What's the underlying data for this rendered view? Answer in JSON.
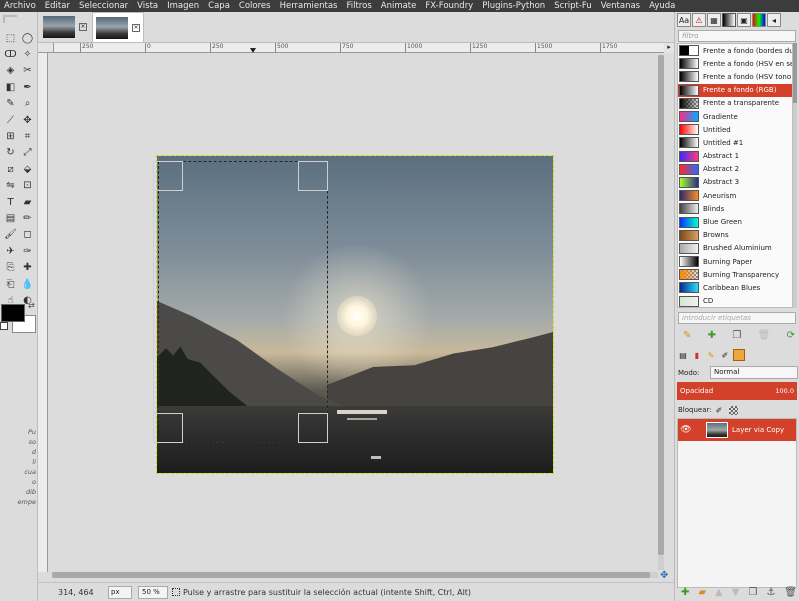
{
  "menu": [
    "Archivo",
    "Editar",
    "Seleccionar",
    "Vista",
    "Imagen",
    "Capa",
    "Colores",
    "Herramientas",
    "Filtros",
    "Animate",
    "FX-Foundry",
    "Plugins-Python",
    "Script-Fu",
    "Ventanas",
    "Ayuda"
  ],
  "toolbox": {
    "tools": [
      "rect-select",
      "ellipse-select",
      "free-select",
      "fuzzy-select",
      "select-by-color",
      "scissors-select",
      "foreground-select",
      "paths",
      "color-picker",
      "zoom",
      "measure",
      "move",
      "align",
      "crop",
      "rotate",
      "scale",
      "shear",
      "perspective",
      "flip",
      "cage-transform",
      "text",
      "bucket-fill",
      "blend",
      "pencil",
      "paintbrush",
      "eraser",
      "airbrush",
      "ink",
      "clone",
      "heal",
      "perspective-clone",
      "blur",
      "smudge",
      "dodge-burn"
    ],
    "options_text": [
      "Pu",
      "so",
      "d",
      "li",
      "cua",
      "o",
      "dib",
      "empe"
    ],
    "fg_color": "#000000",
    "bg_color": "#ffffff"
  },
  "ruler": {
    "labels": [
      "250",
      "0",
      "250",
      "500",
      "750",
      "1000",
      "1250",
      "1500",
      "1750"
    ]
  },
  "statusbar": {
    "coords": "314, 464",
    "unit": "px",
    "zoom": "50 %",
    "message": "Pulse y arrastre para sustituir la selección actual (intente Shift, Ctrl, Alt)"
  },
  "gradients": {
    "filter_placeholder": "filtro",
    "tags_placeholder": "introducir etiquetas",
    "items": [
      {
        "name": "Frente a fondo (bordes duro",
        "colors": [
          "#000000",
          "#ffffff"
        ],
        "hard": true
      },
      {
        "name": "Frente a fondo (HSV en sentido",
        "colors": [
          "#000000",
          "#ffffff"
        ]
      },
      {
        "name": "Frente a fondo (HSV tono en",
        "colors": [
          "#000000",
          "#ffffff"
        ]
      },
      {
        "name": "Frente a fondo (RGB)",
        "colors": [
          "#000000",
          "#ffffff"
        ],
        "selected": true
      },
      {
        "name": "Frente a transparente",
        "colors": [
          "#000000",
          "#cccccc"
        ],
        "checker": true
      },
      {
        "name": "Gradiente",
        "colors": [
          "#ff2a8a",
          "#00aaff"
        ]
      },
      {
        "name": "Untitled",
        "colors": [
          "#ff0000",
          "#ffffff"
        ]
      },
      {
        "name": "Untitled #1",
        "colors": [
          "#000000",
          "#ffffff"
        ]
      },
      {
        "name": "Abstract 1",
        "colors": [
          "#3a2aff",
          "#ff3a7a"
        ]
      },
      {
        "name": "Abstract 2",
        "colors": [
          "#ff2a2a",
          "#2a6aff"
        ]
      },
      {
        "name": "Abstract 3",
        "colors": [
          "#aaff2a",
          "#2a2a8a"
        ]
      },
      {
        "name": "Aneurism",
        "colors": [
          "#2a2a6a",
          "#ff8a2a"
        ]
      },
      {
        "name": "Blinds",
        "colors": [
          "#444444",
          "#eeeeee"
        ]
      },
      {
        "name": "Blue Green",
        "colors": [
          "#0033ff",
          "#00ffcc"
        ]
      },
      {
        "name": "Browns",
        "colors": [
          "#7a4a1a",
          "#d8a060"
        ]
      },
      {
        "name": "Brushed Aluminium",
        "colors": [
          "#aaaaaa",
          "#f0f0f0"
        ]
      },
      {
        "name": "Burning Paper",
        "colors": [
          "#ffffff",
          "#000000"
        ]
      },
      {
        "name": "Burning Transparency",
        "colors": [
          "#ff8a00",
          "#000000"
        ],
        "checker": true
      },
      {
        "name": "Caribbean Blues",
        "colors": [
          "#0a2a8a",
          "#2adaff"
        ]
      },
      {
        "name": "CD",
        "colors": [
          "#d0e8d0",
          "#f0f0f0"
        ]
      }
    ]
  },
  "layers": {
    "mode_label": "Modo:",
    "mode_value": "Normal",
    "opacity_label": "Opacidad",
    "opacity_value": "100.0",
    "lock_label": "Bloquear:",
    "items": [
      {
        "name": "Layer via Copy",
        "visible": true
      }
    ]
  }
}
